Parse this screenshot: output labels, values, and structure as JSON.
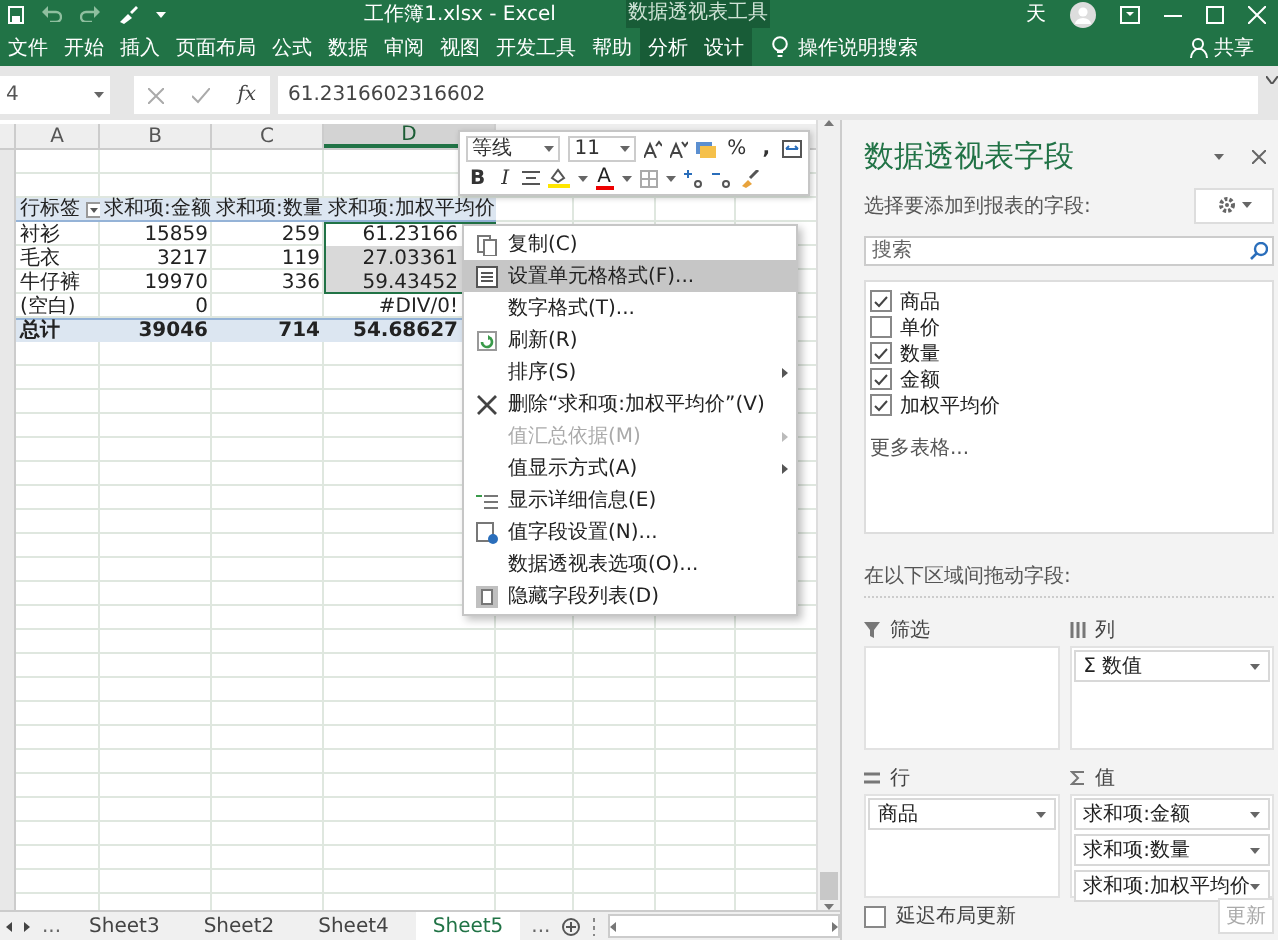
{
  "title_bar": {
    "document_title": "工作簿1.xlsx  -  Excel",
    "contextual_group": "数据透视表工具",
    "user": "天"
  },
  "ribbon": {
    "tabs": [
      {
        "label": "文件",
        "contextual": false
      },
      {
        "label": "开始",
        "contextual": false
      },
      {
        "label": "插入",
        "contextual": false
      },
      {
        "label": "页面布局",
        "contextual": false
      },
      {
        "label": "公式",
        "contextual": false
      },
      {
        "label": "数据",
        "contextual": false
      },
      {
        "label": "审阅",
        "contextual": false
      },
      {
        "label": "视图",
        "contextual": false
      },
      {
        "label": "开发工具",
        "contextual": false
      },
      {
        "label": "帮助",
        "contextual": false
      },
      {
        "label": "分析",
        "contextual": true
      },
      {
        "label": "设计",
        "contextual": true
      }
    ],
    "tell_me": "操作说明搜索",
    "share": "共享"
  },
  "formula_bar": {
    "name_box": "4",
    "function_label": "fx",
    "value": "61.2316602316602"
  },
  "columns": [
    {
      "label": "A",
      "selected": false
    },
    {
      "label": "B",
      "selected": false
    },
    {
      "label": "C",
      "selected": false
    },
    {
      "label": "D",
      "selected": true
    }
  ],
  "pivot_rows": [
    {
      "kind": "header",
      "label": "行标签",
      "cells": [
        "求和项:金额",
        "求和项:数量",
        "求和项:加权平均价"
      ],
      "selected": false
    },
    {
      "kind": "item",
      "label": "衬衫",
      "cells": [
        "15859",
        "259",
        "61.23166"
      ],
      "selected": true
    },
    {
      "kind": "item",
      "label": "毛衣",
      "cells": [
        "3217",
        "119",
        "27.03361"
      ],
      "selected": true
    },
    {
      "kind": "item",
      "label": "牛仔裤",
      "cells": [
        "19970",
        "336",
        "59.43452"
      ],
      "selected": true
    },
    {
      "kind": "item",
      "label": "(空白)",
      "cells": [
        "0",
        null,
        "#DIV/0!"
      ],
      "selected": false
    },
    {
      "kind": "total",
      "label": "总计",
      "cells": [
        "39046",
        "714",
        "54.68627"
      ],
      "selected": false
    }
  ],
  "mini_toolbar": {
    "font": "等线",
    "size": "11",
    "percent": "%",
    "comma": ",",
    "bold": "B",
    "italic": "I",
    "font_color": "A"
  },
  "context_menu": [
    {
      "label": "复制(C)",
      "kind": "command",
      "selected": false,
      "disabled": false
    },
    {
      "label": "设置单元格格式(F)...",
      "kind": "command",
      "selected": true,
      "disabled": false
    },
    {
      "label": "数字格式(T)...",
      "kind": "command",
      "selected": false,
      "disabled": false
    },
    {
      "label": "刷新(R)",
      "kind": "command",
      "selected": false,
      "disabled": false
    },
    {
      "label": "排序(S)",
      "kind": "submenu",
      "selected": false,
      "disabled": false
    },
    {
      "label": "删除“求和项:加权平均价”(V)",
      "kind": "command",
      "selected": false,
      "disabled": false
    },
    {
      "label": "值汇总依据(M)",
      "kind": "submenu",
      "selected": false,
      "disabled": true
    },
    {
      "label": "值显示方式(A)",
      "kind": "submenu",
      "selected": false,
      "disabled": false
    },
    {
      "label": "显示详细信息(E)",
      "kind": "command",
      "selected": false,
      "disabled": false
    },
    {
      "label": "值字段设置(N)...",
      "kind": "command",
      "selected": false,
      "disabled": false
    },
    {
      "label": "数据透视表选项(O)...",
      "kind": "command",
      "selected": false,
      "disabled": false
    },
    {
      "label": "隐藏字段列表(D)",
      "kind": "command",
      "selected": false,
      "disabled": false
    }
  ],
  "field_pane": {
    "title": "数据透视表字段",
    "subtitle": "选择要添加到报表的字段:",
    "search_placeholder": "搜索",
    "fields": [
      {
        "label": "商品",
        "checked": true
      },
      {
        "label": "单价",
        "checked": false
      },
      {
        "label": "数量",
        "checked": true
      },
      {
        "label": "金额",
        "checked": true
      },
      {
        "label": "加权平均价",
        "checked": true
      }
    ],
    "more_tables": "更多表格...",
    "drag_hint": "在以下区域间拖动字段:",
    "areas": [
      {
        "kind": "filter",
        "label": "筛选"
      },
      {
        "kind": "columns",
        "label": "列",
        "items": [
          "Σ 数值"
        ]
      },
      {
        "kind": "rows",
        "label": "行",
        "items": [
          "商品"
        ]
      },
      {
        "kind": "values",
        "label": "值",
        "items": [
          "求和项:金额",
          "求和项:数量",
          "求和项:加权平均价"
        ]
      }
    ],
    "defer_update": {
      "label": "延迟布局更新",
      "checked": false
    },
    "update_button": {
      "label": "更新",
      "disabled": true
    }
  },
  "sheet_tabs": {
    "more_left": "...",
    "tabs": [
      {
        "label": "Sheet3",
        "selected": false
      },
      {
        "label": "Sheet2",
        "selected": false
      },
      {
        "label": "Sheet4",
        "selected": false
      },
      {
        "label": "Sheet5",
        "selected": true
      }
    ],
    "more_right": "..."
  }
}
